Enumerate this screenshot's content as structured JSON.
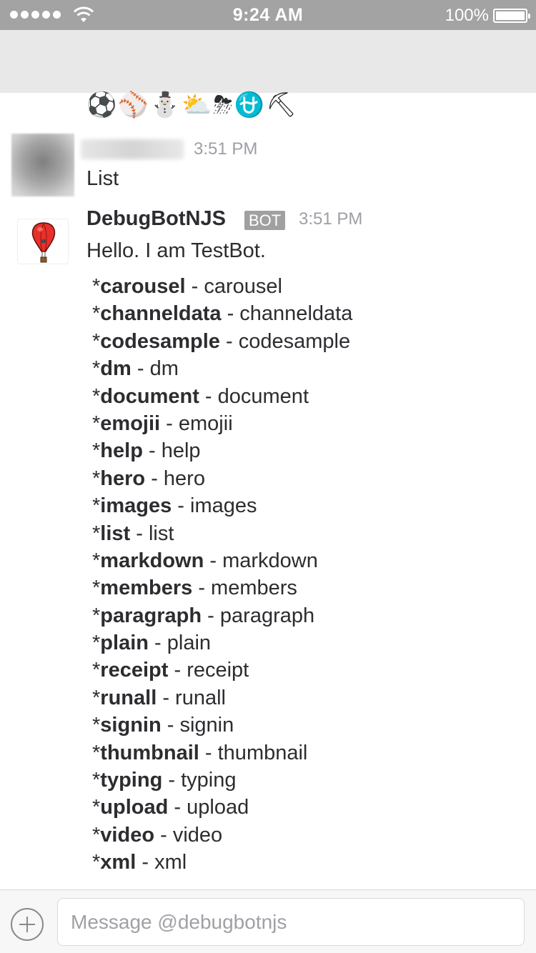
{
  "status_bar": {
    "time": "9:24 AM",
    "battery": "100%"
  },
  "emoji_row": [
    "⚽",
    "⚾",
    "⛄",
    "⛅",
    "⛈",
    "⛎",
    "⛏"
  ],
  "messages": {
    "user": {
      "time": "3:51 PM",
      "text": "List"
    },
    "bot": {
      "name": "DebugBotNJS",
      "badge": "BOT",
      "time": "3:51 PM",
      "greeting": "Hello. I am TestBot.",
      "commands": [
        {
          "cmd": "carousel",
          "desc": "carousel"
        },
        {
          "cmd": "channeldata",
          "desc": "channeldata"
        },
        {
          "cmd": "codesample",
          "desc": "codesample"
        },
        {
          "cmd": "dm",
          "desc": "dm"
        },
        {
          "cmd": "document",
          "desc": "document"
        },
        {
          "cmd": "emojii",
          "desc": "emojii"
        },
        {
          "cmd": "help",
          "desc": "help"
        },
        {
          "cmd": "hero",
          "desc": "hero"
        },
        {
          "cmd": "images",
          "desc": "images"
        },
        {
          "cmd": "list",
          "desc": "list"
        },
        {
          "cmd": "markdown",
          "desc": "markdown"
        },
        {
          "cmd": "members",
          "desc": "members"
        },
        {
          "cmd": "paragraph",
          "desc": "paragraph"
        },
        {
          "cmd": "plain",
          "desc": "plain"
        },
        {
          "cmd": "receipt",
          "desc": "receipt"
        },
        {
          "cmd": "runall",
          "desc": "runall"
        },
        {
          "cmd": "signin",
          "desc": "signin"
        },
        {
          "cmd": "thumbnail",
          "desc": "thumbnail"
        },
        {
          "cmd": "typing",
          "desc": "typing"
        },
        {
          "cmd": "upload",
          "desc": "upload"
        },
        {
          "cmd": "video",
          "desc": "video"
        },
        {
          "cmd": "xml",
          "desc": "xml"
        }
      ]
    }
  },
  "composer": {
    "placeholder": "Message @debugbotnjs"
  }
}
